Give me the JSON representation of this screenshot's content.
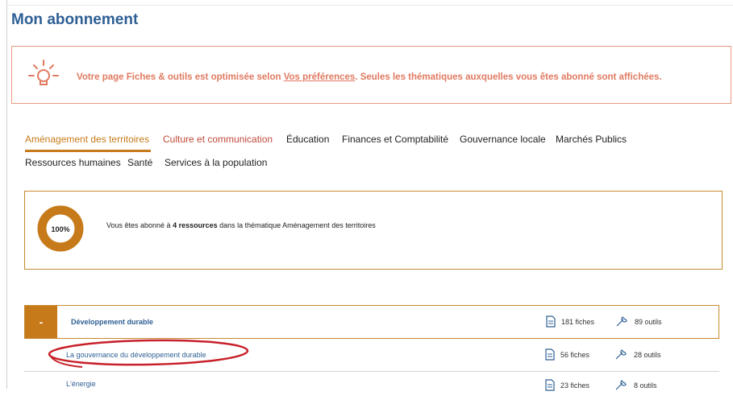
{
  "page": {
    "title": "Mon abonnement"
  },
  "notice": {
    "text_before": "Votre page Fiches & outils est optimisée selon ",
    "link": "Vos préférences",
    "text_after": ". Seules les thématiques auxquelles vous êtes abonné sont affichées.",
    "icon": "lightbulb-icon"
  },
  "tabs": [
    {
      "label": "Aménagement des territoires",
      "active": true
    },
    {
      "label": "Culture et communication"
    },
    {
      "label": "Éducation"
    },
    {
      "label": "Finances et Comptabilité"
    },
    {
      "label": "Gouvernance locale"
    },
    {
      "label": "Marchés Publics"
    },
    {
      "label": "Ressources humaines"
    },
    {
      "label": "Santé"
    },
    {
      "label": "Services à la population"
    }
  ],
  "summary": {
    "percent": "100%",
    "text_before": "Vous êtes abonné à ",
    "text_bold": "4 ressources",
    "text_after": " dans la thématique Aménagement des territoires"
  },
  "accordion": {
    "toggle": "-",
    "title": "Développement durable",
    "fiches": "181 fiches",
    "outils": "89 outils",
    "items": [
      {
        "name": "La gouvernance du développement durable",
        "fiches": "56 fiches",
        "outils": "28 outils"
      },
      {
        "name": "L'énergie",
        "fiches": "23 fiches",
        "outils": "8 outils"
      }
    ]
  },
  "colors": {
    "title_blue": "#2e5f94",
    "accent_orange": "#c67a1a",
    "notice_coral": "#e07a61",
    "highlight_red": "#c8202a"
  }
}
